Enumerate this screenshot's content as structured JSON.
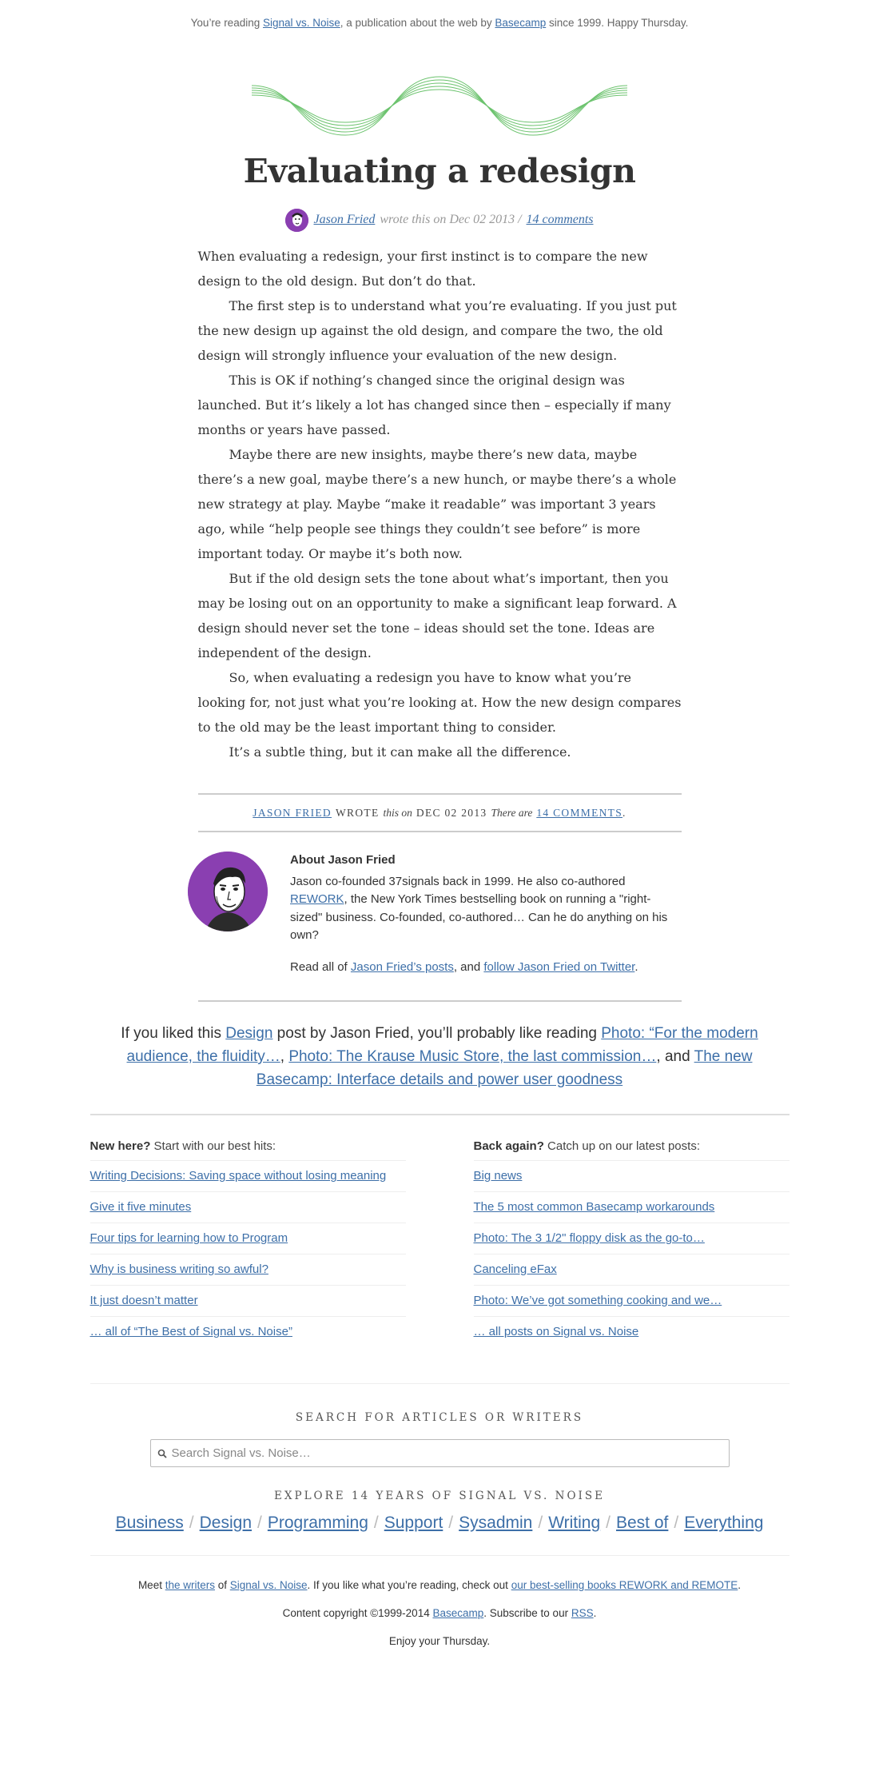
{
  "topnote": {
    "prefix": "You’re reading ",
    "publication": "Signal vs. Noise",
    "middle": ", a publication about the web by ",
    "company": "Basecamp",
    "suffix": " since 1999. Happy Thursday."
  },
  "post": {
    "title": "Evaluating a redesign",
    "author": "Jason Fried",
    "wrote_text": "wrote this on Dec 02 2013 /",
    "comments": "14 comments",
    "paragraphs": [
      "When evaluating a redesign, your first instinct is to compare the new design to the old design. But don’t do that.",
      "The first step is to understand what you’re evaluating. If you just put the new design up against the old design, and compare the two, the old design will strongly influence your evaluation of the new design.",
      "This is OK if nothing’s changed since the original design was launched. But it’s likely a lot has changed since then – especially if many months or years have passed.",
      "Maybe there are new insights, maybe there’s new data, maybe there’s a new goal, maybe there’s a new hunch, or maybe there’s a whole new strategy at play. Maybe “make it readable” was important 3 years ago, while “help people see things they couldn’t see before” is more important today. Or maybe it’s both now.",
      "But if the old design sets the tone about what’s important, then you may be losing out on an opportunity to make a significant leap forward. A design should never set the tone – ideas should set the tone. Ideas are independent of the design.",
      "So, when evaluating a redesign you have to know what you’re looking for, not just what you’re looking at. How the new design compares to the old may be the least important thing to consider.",
      "It’s a subtle thing, but it can make all the difference."
    ]
  },
  "meta": {
    "author": "JASON FRIED",
    "wrote": "WROTE",
    "this_on": "this on",
    "date": "DEC 02 2013",
    "there_are": "There are",
    "comments": "14 COMMENTS",
    "period": "."
  },
  "about": {
    "title": "About Jason Fried",
    "text_before": "Jason co-founded 37signals back in 1999. He also co-authored ",
    "book": "REWORK",
    "text_after": ", the New York Times bestselling book on running a \"right-sized\" business. Co-founded, co-authored… Can he do anything on his own?",
    "read_prefix": "Read all of ",
    "posts_link": "Jason Fried’s posts",
    "read_middle": ", and ",
    "twitter_link": "follow Jason Fried on Twitter",
    "read_suffix": "."
  },
  "related": {
    "prefix": "If you liked this ",
    "category": "Design",
    "middle": " post by Jason Fried, you’ll probably like reading ",
    "link1": "Photo: “For the modern audience, the fluidity…",
    "sep1": ", ",
    "link2": "Photo: The Krause Music Store, the last commission…",
    "sep2": ", and ",
    "link3": "The new Basecamp: Interface details and power user goodness"
  },
  "best_hits": {
    "bold": "New here?",
    "text": " Start with our best hits:",
    "items": [
      "Writing Decisions: Saving space without losing meaning",
      "Give it five minutes",
      "Four tips for learning how to Program",
      "Why is business writing so awful?",
      "It just doesn’t matter",
      "… all of “The Best of Signal vs. Noise”"
    ]
  },
  "latest": {
    "bold": "Back again?",
    "text": " Catch up on our latest posts:",
    "items": [
      "Big news",
      "The 5 most common Basecamp workarounds",
      "Photo: The 3 1/2\" floppy disk as the go-to…",
      "Canceling eFax",
      "Photo: We’ve got something cooking and we…",
      "… all posts on Signal vs. Noise"
    ]
  },
  "search": {
    "label": "SEARCH FOR ARTICLES OR WRITERS",
    "placeholder": "Search Signal vs. Noise…",
    "icon": "search-icon"
  },
  "explore": {
    "label": "EXPLORE 14 YEARS OF SIGNAL VS. NOISE",
    "sep": "/",
    "categories": [
      "Business",
      "Design",
      "Programming",
      "Support",
      "Sysadmin",
      "Writing",
      "Best of",
      "Everything"
    ]
  },
  "footer": {
    "meet": "Meet ",
    "writers": "the writers",
    "of": " of ",
    "svn": "Signal vs. Noise",
    "like": ". If you like what you’re reading, check out ",
    "books": "our best-selling books REWORK and REMOTE",
    "end": ".",
    "copyright": "Content copyright ©1999-2014 ",
    "basecamp": "Basecamp",
    "subscribe": ". Subscribe to our ",
    "rss": "RSS",
    "period": ".",
    "enjoy": "Enjoy your Thursday."
  },
  "colors": {
    "link": "#3d6fa8",
    "wave": "#6cc36e",
    "avatar": "#8a3fb1"
  }
}
